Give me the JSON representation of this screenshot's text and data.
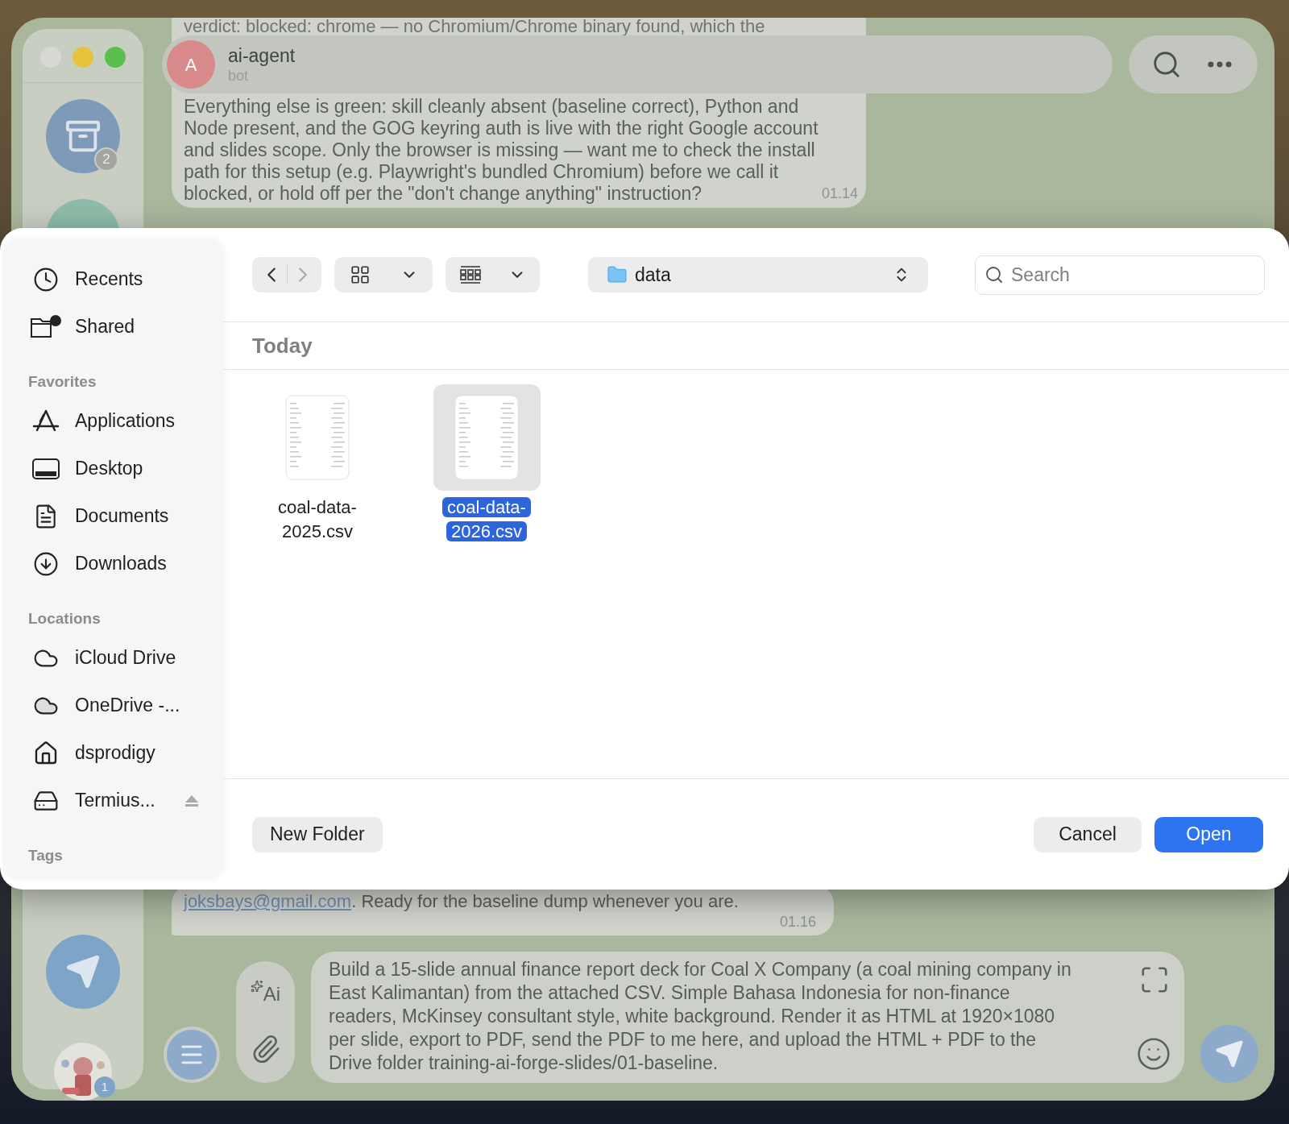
{
  "chat_list": {
    "archive_badge": "2",
    "chat_badge": "1"
  },
  "chat_header": {
    "avatar_letter": "A",
    "title": "ai-agent",
    "subtitle": "bot"
  },
  "top_message": {
    "first_line": "verdict: blocked: chrome — no Chromium/Chrome binary found, which the",
    "body": "Everything else is green: skill cleanly absent (baseline correct), Python and Node present, and the GOG keyring auth is live with the right Google account and slides scope. Only the browser is missing — want me to check the install path for this setup (e.g. Playwright's bundled Chromium) before we call it blocked, or hold off per the \"don't change anything\" instruction?",
    "time": "01.14"
  },
  "bottom_message": {
    "link": "joksbays@gmail.com",
    "text": ". Ready for the baseline dump whenever you are.",
    "time": "01.16"
  },
  "composer": {
    "ai_label": "Ai",
    "value": "Build a 15-slide annual finance report deck for Coal X Company (a coal mining company in East Kalimantan) from the attached CSV. Simple Bahasa Indonesia for non-finance readers, McKinsey consultant style, white background. Render it as HTML at 1920×1080 per slide, export to PDF, send the PDF to me here, and upload the HTML + PDF to the Drive folder training-ai-forge-slides/01-baseline."
  },
  "dialog": {
    "sidebar": [
      {
        "kind": "item",
        "label": "Recents"
      },
      {
        "kind": "item",
        "label": "Shared"
      },
      {
        "kind": "header",
        "label": "Favorites"
      },
      {
        "kind": "item",
        "label": "Applications"
      },
      {
        "kind": "item",
        "label": "Desktop"
      },
      {
        "kind": "item",
        "label": "Documents"
      },
      {
        "kind": "item",
        "label": "Downloads"
      },
      {
        "kind": "header",
        "label": "Locations"
      },
      {
        "kind": "item",
        "label": "iCloud Drive"
      },
      {
        "kind": "item",
        "label": "OneDrive -..."
      },
      {
        "kind": "item",
        "label": "dsprodigy"
      },
      {
        "kind": "item",
        "label": "Termius...",
        "eject": true
      },
      {
        "kind": "header",
        "label": "Tags"
      }
    ],
    "location": "data",
    "search": {
      "placeholder": "Search"
    },
    "section": "Today",
    "files": [
      {
        "name": "coal-data-2025.csv",
        "selected": false
      },
      {
        "name": "coal-data-2026.csv",
        "selected": true
      }
    ],
    "buttons": {
      "new_folder": "New Folder",
      "cancel": "Cancel",
      "open": "Open"
    }
  }
}
